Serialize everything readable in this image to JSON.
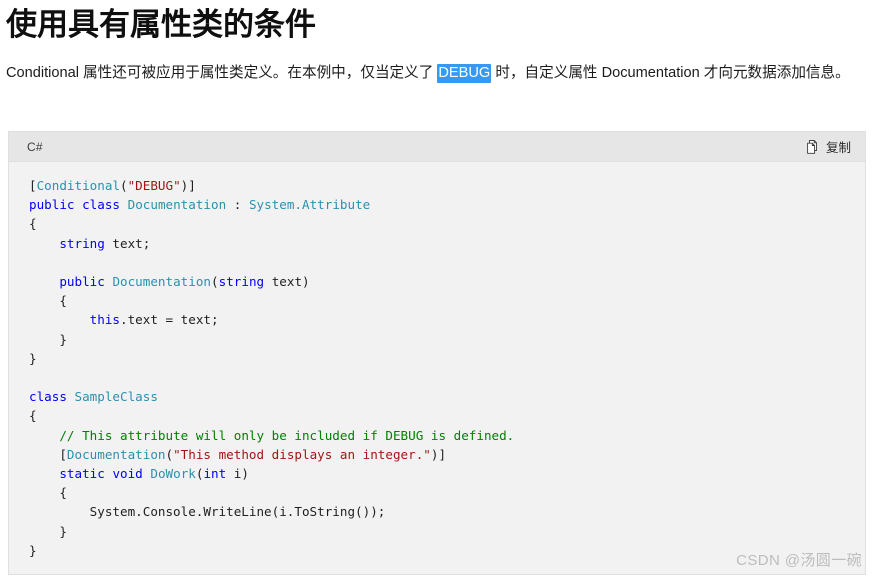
{
  "page": {
    "title": "使用具有属性类的条件",
    "intro": {
      "before": "Conditional 属性还可被应用于属性类定义。在本例中，仅当定义了 ",
      "highlight": "DEBUG",
      "after": " 时，自定义属性 Documentation 才向元数据添加信息。",
      "highlight_color": "#3899f5"
    }
  },
  "code_block": {
    "language_label": "C#",
    "copy_label": "复制",
    "copy_icon": "copy-pages-icon",
    "background": "#f2f2f2",
    "header_background": "#e6e6e6",
    "syntax_colors": {
      "keyword": "#0000ff",
      "type": "#2b91af",
      "string": "#a31515",
      "comment": "#008000",
      "plain": "#1f1f1f"
    },
    "lines": [
      [
        {
          "t": "[",
          "c": "pln"
        },
        {
          "t": "Conditional",
          "c": "type"
        },
        {
          "t": "(",
          "c": "pln"
        },
        {
          "t": "\"DEBUG\"",
          "c": "str"
        },
        {
          "t": ")]",
          "c": "pln"
        }
      ],
      [
        {
          "t": "public",
          "c": "kw"
        },
        {
          "t": " ",
          "c": "pln"
        },
        {
          "t": "class",
          "c": "kw"
        },
        {
          "t": " ",
          "c": "pln"
        },
        {
          "t": "Documentation",
          "c": "type"
        },
        {
          "t": " : ",
          "c": "pln"
        },
        {
          "t": "System.Attribute",
          "c": "type"
        }
      ],
      [
        {
          "t": "{",
          "c": "pln"
        }
      ],
      [
        {
          "t": "    ",
          "c": "pln"
        },
        {
          "t": "string",
          "c": "kw"
        },
        {
          "t": " text;",
          "c": "pln"
        }
      ],
      [],
      [
        {
          "t": "    ",
          "c": "pln"
        },
        {
          "t": "public",
          "c": "kw"
        },
        {
          "t": " ",
          "c": "pln"
        },
        {
          "t": "Documentation",
          "c": "type"
        },
        {
          "t": "(",
          "c": "pln"
        },
        {
          "t": "string",
          "c": "kw"
        },
        {
          "t": " text)",
          "c": "pln"
        }
      ],
      [
        {
          "t": "    {",
          "c": "pln"
        }
      ],
      [
        {
          "t": "        ",
          "c": "pln"
        },
        {
          "t": "this",
          "c": "kw"
        },
        {
          "t": ".text = text;",
          "c": "pln"
        }
      ],
      [
        {
          "t": "    }",
          "c": "pln"
        }
      ],
      [
        {
          "t": "}",
          "c": "pln"
        }
      ],
      [],
      [
        {
          "t": "class",
          "c": "kw"
        },
        {
          "t": " ",
          "c": "pln"
        },
        {
          "t": "SampleClass",
          "c": "type"
        }
      ],
      [
        {
          "t": "{",
          "c": "pln"
        }
      ],
      [
        {
          "t": "    ",
          "c": "pln"
        },
        {
          "t": "// This attribute will only be included if DEBUG is defined.",
          "c": "cmt"
        }
      ],
      [
        {
          "t": "    [",
          "c": "pln"
        },
        {
          "t": "Documentation",
          "c": "type"
        },
        {
          "t": "(",
          "c": "pln"
        },
        {
          "t": "\"This method displays an integer.\"",
          "c": "str"
        },
        {
          "t": ")]",
          "c": "pln"
        }
      ],
      [
        {
          "t": "    ",
          "c": "pln"
        },
        {
          "t": "static",
          "c": "kw"
        },
        {
          "t": " ",
          "c": "pln"
        },
        {
          "t": "void",
          "c": "kw"
        },
        {
          "t": " ",
          "c": "pln"
        },
        {
          "t": "DoWork",
          "c": "type"
        },
        {
          "t": "(",
          "c": "pln"
        },
        {
          "t": "int",
          "c": "kw"
        },
        {
          "t": " i)",
          "c": "pln"
        }
      ],
      [
        {
          "t": "    {",
          "c": "pln"
        }
      ],
      [
        {
          "t": "        System.Console.WriteLine(i.ToString());",
          "c": "pln"
        }
      ],
      [
        {
          "t": "    }",
          "c": "pln"
        }
      ],
      [
        {
          "t": "}",
          "c": "pln"
        }
      ]
    ]
  },
  "watermark": {
    "text": "CSDN @汤圆一碗"
  }
}
